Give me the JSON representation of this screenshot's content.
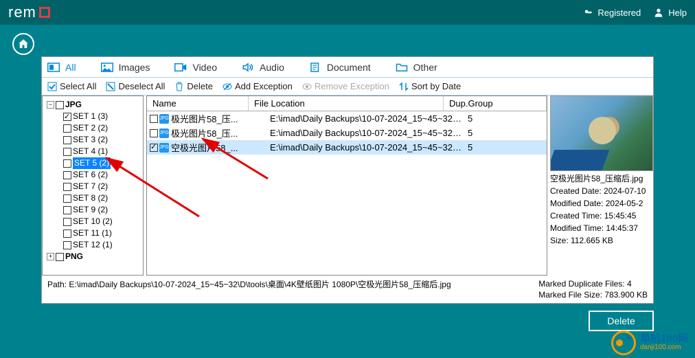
{
  "topbar": {
    "brand": "rem",
    "registered": "Registered",
    "help": "Help"
  },
  "tabs": {
    "all": "All",
    "images": "Images",
    "video": "Video",
    "audio": "Audio",
    "document": "Document",
    "other": "Other"
  },
  "tools": {
    "selectall": "Select All",
    "deselectall": "Deselect All",
    "delete": "Delete",
    "addexc": "Add Exception",
    "remexc": "Remove Exception",
    "sortdate": "Sort by Date"
  },
  "tree": {
    "root": "JPG",
    "items": [
      {
        "label": "SET 1 (3)",
        "checked": true
      },
      {
        "label": "SET 2 (2)",
        "checked": false
      },
      {
        "label": "SET 3 (2)",
        "checked": false
      },
      {
        "label": "SET 4 (1)",
        "checked": false
      },
      {
        "label": "SET 5 (2)",
        "checked": false,
        "selected": true
      },
      {
        "label": "SET 6 (2)",
        "checked": false
      },
      {
        "label": "SET 7 (2)",
        "checked": false
      },
      {
        "label": "SET 8 (2)",
        "checked": false
      },
      {
        "label": "SET 9 (2)",
        "checked": false
      },
      {
        "label": "SET 10 (2)",
        "checked": false
      },
      {
        "label": "SET 11 (1)",
        "checked": false
      },
      {
        "label": "SET 12 (1)",
        "checked": false
      }
    ],
    "foot": "PNG"
  },
  "table": {
    "headers": {
      "name": "Name",
      "loc": "File Location",
      "grp": "Dup.Group"
    },
    "rows": [
      {
        "checked": false,
        "name": "极光图片58_压...",
        "loc": "E:\\imad\\Daily Backups\\10-07-2024_15~45~32\\...",
        "grp": "5",
        "sel": false
      },
      {
        "checked": false,
        "name": "极光图片58_压...",
        "loc": "E:\\imad\\Daily Backups\\10-07-2024_15~45~32\\...",
        "grp": "5",
        "sel": false
      },
      {
        "checked": true,
        "name": "空极光图片58_...",
        "loc": "E:\\imad\\Daily Backups\\10-07-2024_15~45~32\\...",
        "grp": "5",
        "sel": true
      }
    ]
  },
  "preview": {
    "filename": "空极光图片58_压缩后.jpg",
    "cd_lbl": "Created Date: ",
    "cd": "2024-07-10",
    "md_lbl": "Modified Date: ",
    "md": "2024-05-2",
    "ct_lbl": "Created Time: ",
    "ct": "15:45:45",
    "mt_lbl": "Modified Time: ",
    "mt": "14:45:37",
    "sz_lbl": "Size: ",
    "sz": "112.665 KB"
  },
  "status": {
    "path_lbl": "Path:  ",
    "path": "E:\\imad\\Daily Backups\\10-07-2024_15~45~32\\D\\tools\\桌面\\4K壁纸图片 1080P\\空极光图片58_压缩后.jpg",
    "mdf_lbl": "Marked Duplicate Files: ",
    "mdf": "4",
    "mfs_lbl": "Marked File Size: ",
    "mfs": "783.900 KB"
  },
  "delete": "Delete",
  "footer": {
    "t1": "单机100网",
    "t2": "danji100.com"
  }
}
